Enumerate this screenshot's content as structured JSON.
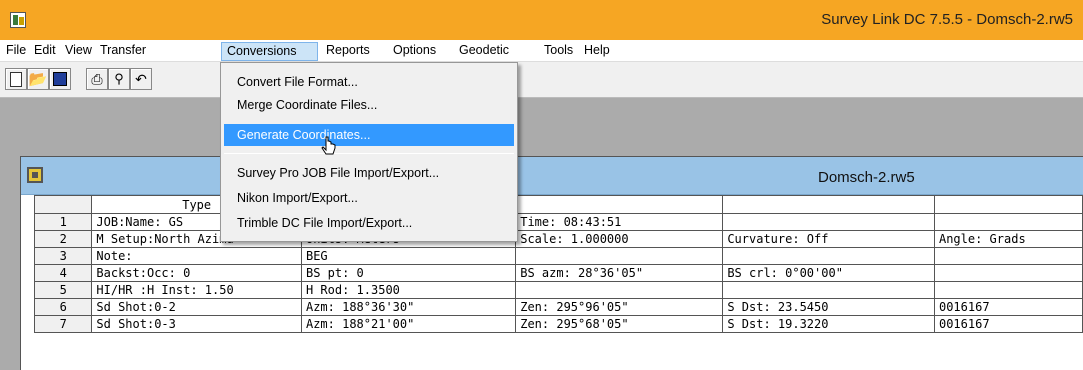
{
  "window": {
    "title": "Survey Link DC 7.5.5 - Domsch-2.rw5",
    "icon": "app-icon"
  },
  "menubar": {
    "items": [
      "File",
      "Edit",
      "View",
      "Transfer",
      "Conversions",
      "Reports",
      "Options",
      "Geodetic",
      "Tools",
      "Help"
    ],
    "active": "Conversions"
  },
  "toolbar": {
    "buttons": [
      "new-icon",
      "open-icon",
      "save-icon",
      "print-icon",
      "print-preview-icon",
      "undo-icon"
    ]
  },
  "conversions_menu": {
    "items": [
      "Convert File Format...",
      "Merge Coordinate Files...",
      "Generate Coordinates...",
      "Survey Pro JOB File Import/Export...",
      "Nikon Import/Export...",
      "Trimble DC File Import/Export..."
    ],
    "highlighted": "Generate Coordinates..."
  },
  "document": {
    "title": "Domsch-2.rw5",
    "header": [
      "Type",
      "",
      "",
      "",
      ""
    ],
    "rows": [
      {
        "num": "1",
        "cells": [
          "JOB:Name: GS",
          "",
          "Time: 08:43:51",
          "",
          ""
        ]
      },
      {
        "num": "2",
        "cells": [
          "M Setup:North Azimu",
          "Units: Meters",
          "Scale: 1.000000",
          "Curvature: Off",
          "Angle: Grads"
        ]
      },
      {
        "num": "3",
        "cells": [
          "Note:",
          "BEG",
          "",
          "",
          ""
        ]
      },
      {
        "num": "4",
        "cells": [
          "Backst:Occ: 0",
          "BS pt: 0",
          "BS azm: 28°36'05\"",
          "BS crl: 0°00'00\"",
          ""
        ]
      },
      {
        "num": "5",
        "cells": [
          "HI/HR :H Inst: 1.50",
          "H Rod: 1.3500",
          "",
          "",
          ""
        ]
      },
      {
        "num": "6",
        "cells": [
          "Sd Shot:0-2",
          "Azm: 188°36'30\"",
          "Zen: 295°96'05\"",
          "S Dst: 23.5450",
          "0016167"
        ]
      },
      {
        "num": "7",
        "cells": [
          "Sd Shot:0-3",
          "Azm: 188°21'00\"",
          "Zen: 295°68'05\"",
          "S Dst: 19.3220",
          "0016167"
        ]
      }
    ]
  },
  "colors": {
    "titlebar": "#f6a623",
    "child_titlebar": "#99c3e6",
    "menu_highlight": "#3399ff",
    "workspace": "#ababab"
  }
}
